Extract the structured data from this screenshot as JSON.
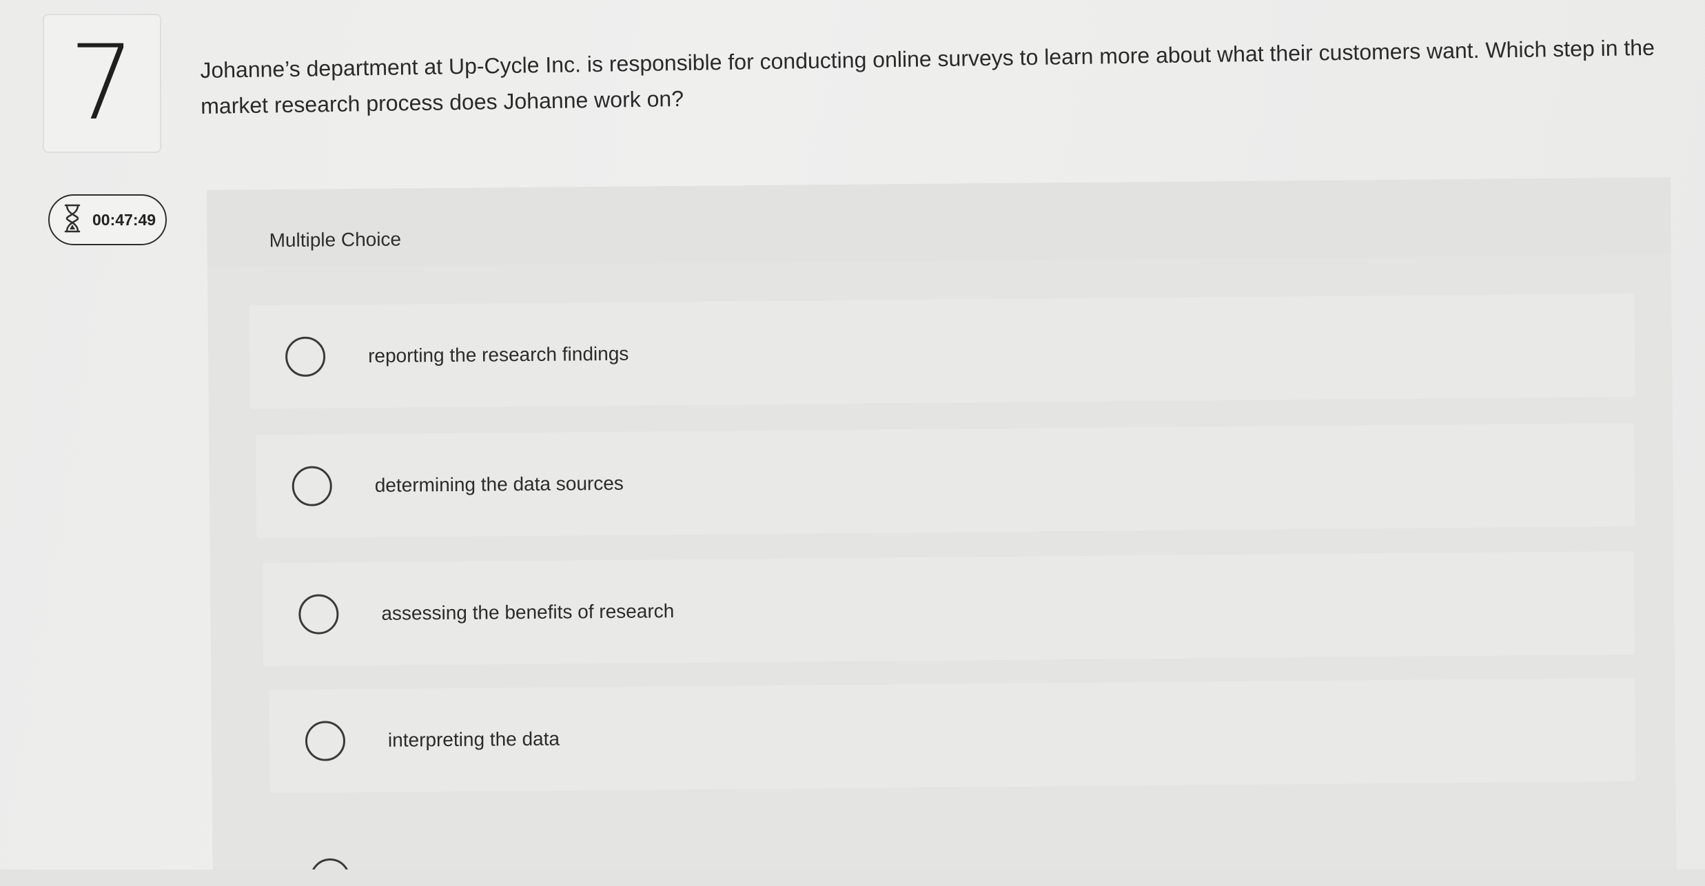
{
  "question": {
    "number": "7",
    "text": "Johanne’s department at Up-Cycle Inc. is responsible for conducting online surveys to learn more about what their customers want. Which step in the market research process does Johanne work on?"
  },
  "timer": {
    "icon": "hourglass-icon",
    "value": "00:47:49"
  },
  "multiple_choice": {
    "label": "Multiple Choice",
    "options": [
      {
        "label": "reporting the research findings"
      },
      {
        "label": "determining the data sources"
      },
      {
        "label": "assessing the benefits of research"
      },
      {
        "label": "interpreting the data"
      }
    ]
  },
  "colors": {
    "background": "#ebebea",
    "panel": "#e4e4e3",
    "option_row": "#e9e9e8",
    "text": "#2b2b2b"
  }
}
